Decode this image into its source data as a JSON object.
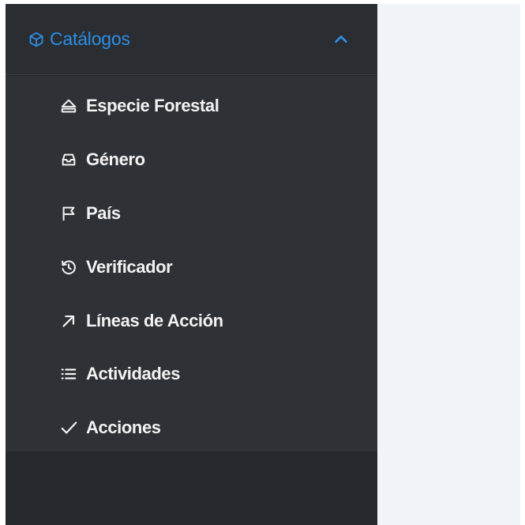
{
  "sidebar": {
    "section": {
      "label": "Catálogos",
      "icon": "cube-icon",
      "toggle_icon": "chevron-up-icon",
      "expanded": true,
      "accent_color": "#2f8de4"
    },
    "items": [
      {
        "label": "Especie Forestal",
        "icon": "eject-icon"
      },
      {
        "label": "Género",
        "icon": "inbox-icon"
      },
      {
        "label": "País",
        "icon": "flag-icon"
      },
      {
        "label": "Verificador",
        "icon": "history-icon"
      },
      {
        "label": "Líneas de Acción",
        "icon": "arrow-up-right-icon"
      },
      {
        "label": "Actividades",
        "icon": "list-icon"
      },
      {
        "label": "Acciones",
        "icon": "check-icon"
      }
    ],
    "colors": {
      "background": "#25282c",
      "submenu_background": "#2e3136",
      "item_text": "#f2f2f2"
    }
  },
  "content": {
    "background": "#f0f3f8"
  }
}
